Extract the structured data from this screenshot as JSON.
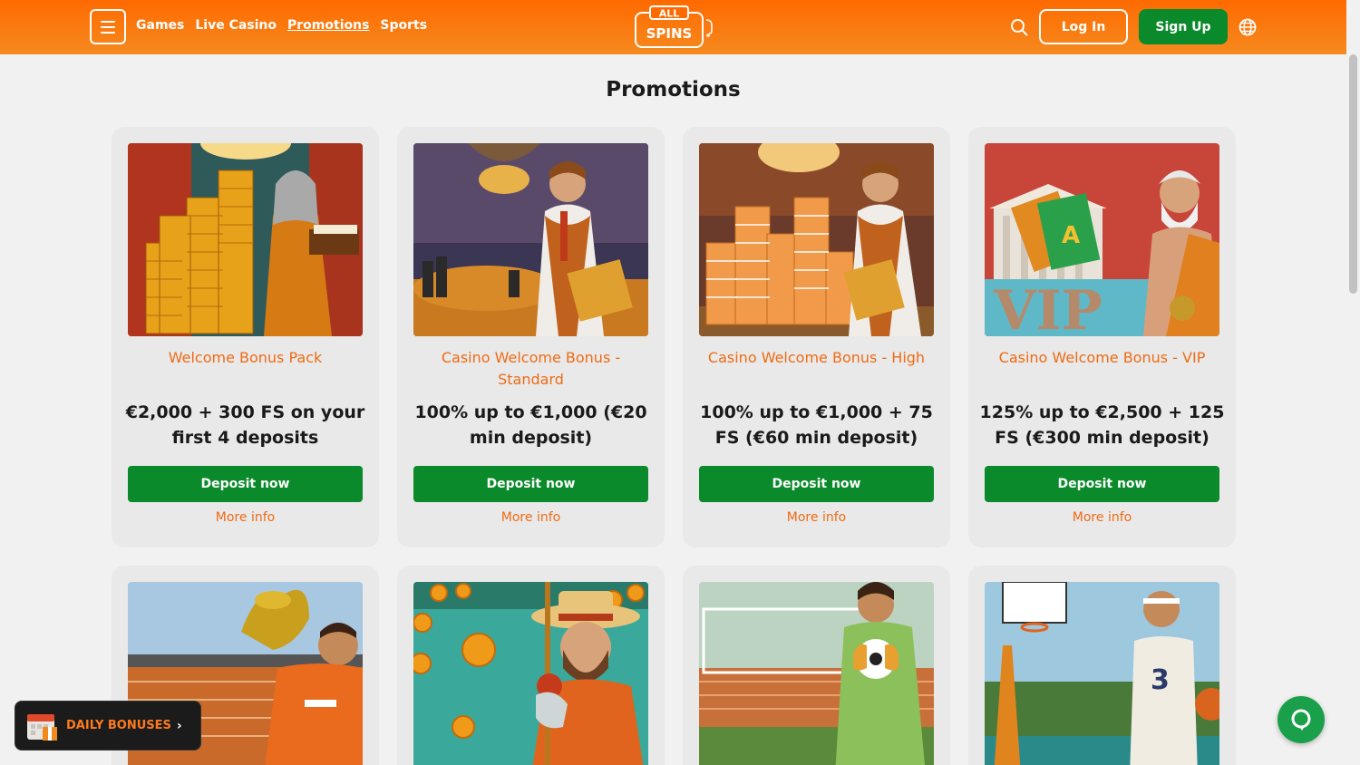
{
  "header": {
    "nav": [
      "Games",
      "Live Casino",
      "Promotions",
      "Sports"
    ],
    "active_nav": "Promotions",
    "logo_line1": "ALL",
    "logo_line2": "SPINS",
    "login_label": "Log In",
    "signup_label": "Sign Up"
  },
  "page": {
    "title": "Promotions"
  },
  "promotions": [
    {
      "title": "Welcome Bonus Pack",
      "offer": "€2,000 + 300 FS on your first 4 deposits",
      "button": "Deposit now",
      "link": "More info",
      "image": "wizard-with-coin-stacks"
    },
    {
      "title": "Casino Welcome Bonus - Standard",
      "offer": "100% up to €1,000 (€20 min deposit)",
      "button": "Deposit now",
      "link": "More info",
      "image": "dealer-in-casino"
    },
    {
      "title": "Casino Welcome Bonus - High",
      "offer": "100% up to €1,000 + 75 FS (€60 min deposit)",
      "button": "Deposit now",
      "link": "More info",
      "image": "dealer-with-chip-stacks"
    },
    {
      "title": "Casino Welcome Bonus - VIP",
      "offer": "125% up to €2,500 + 125 FS (€300 min deposit)",
      "button": "Deposit now",
      "link": "More info",
      "image": "greek-god-vip"
    },
    {
      "image": "football-trophy"
    },
    {
      "image": "cowboy-with-chips"
    },
    {
      "image": "goalkeeper-stadium"
    },
    {
      "image": "basketball-player"
    }
  ],
  "floating": {
    "daily_bonuses": "DAILY BONUSES",
    "chat": "chat"
  },
  "colors": {
    "header_orange": "#ff6a00",
    "accent_orange": "#f06b14",
    "green": "#0a8a2a"
  }
}
